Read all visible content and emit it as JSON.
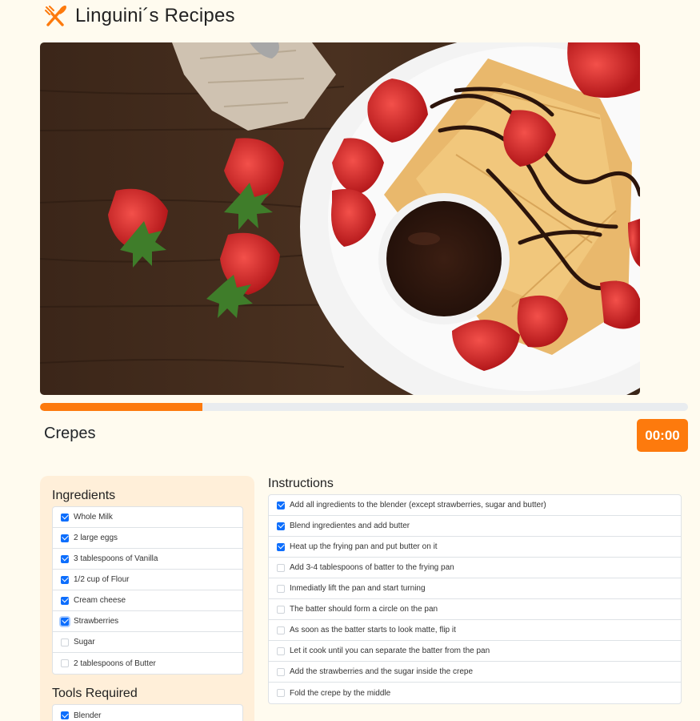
{
  "app": {
    "title": "Linguini´s Recipes",
    "logo_icon": "fork-knife-icon",
    "accent": "#fd7a0d"
  },
  "hero": {
    "image": "crepes-with-strawberries-and-chocolate-photo"
  },
  "progress": {
    "percent": 25
  },
  "recipe": {
    "title": "Crepes"
  },
  "timer": {
    "label": "00:00"
  },
  "ingredients": {
    "heading": "Ingredients",
    "items": [
      {
        "label": "Whole Milk",
        "checked": true
      },
      {
        "label": "2 large eggs",
        "checked": true
      },
      {
        "label": "3 tablespoons of Vanilla",
        "checked": true
      },
      {
        "label": "1/2 cup of Flour",
        "checked": true
      },
      {
        "label": "Cream cheese",
        "checked": true
      },
      {
        "label": "Strawberries",
        "checked": true,
        "focused": true
      },
      {
        "label": "Sugar",
        "checked": false
      },
      {
        "label": "2 tablespoons of Butter",
        "checked": false
      }
    ]
  },
  "tools": {
    "heading": "Tools Required",
    "items": [
      {
        "label": "Blender",
        "checked": true
      }
    ]
  },
  "instructions": {
    "heading": "Instructions",
    "items": [
      {
        "label": "Add all ingredients to the blender (except strawberries, sugar and butter)",
        "checked": true
      },
      {
        "label": "Blend ingredientes and add butter",
        "checked": true
      },
      {
        "label": "Heat up the frying pan and put butter on it",
        "checked": true
      },
      {
        "label": "Add 3-4 tablespoons of batter to the frying pan",
        "checked": false
      },
      {
        "label": "Inmediatly lift the pan and start turning",
        "checked": false
      },
      {
        "label": "The batter should form a circle on the pan",
        "checked": false
      },
      {
        "label": "As soon as the batter starts to look matte, flip it",
        "checked": false
      },
      {
        "label": "Let it cook until you can separate the batter from the pan",
        "checked": false
      },
      {
        "label": "Add the strawberries and the sugar inside the crepe",
        "checked": false
      },
      {
        "label": "Fold the crepe by the middle",
        "checked": false
      }
    ]
  }
}
